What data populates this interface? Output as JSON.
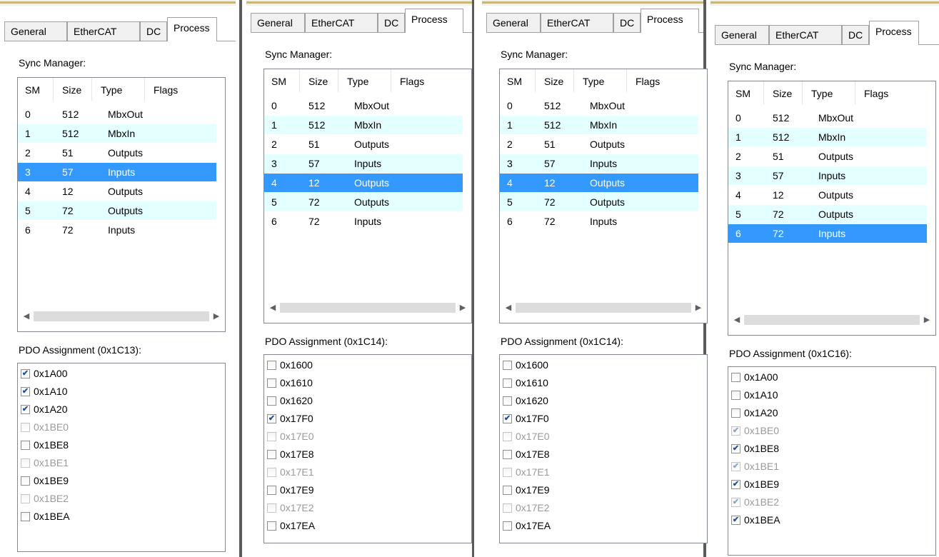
{
  "tabs": [
    "General",
    "EtherCAT",
    "DC",
    "Process"
  ],
  "sync_manager_label": "Sync Manager:",
  "columns": [
    "SM",
    "Size",
    "Type",
    "Flags"
  ],
  "sync_rows": [
    {
      "sm": "0",
      "size": "512",
      "type": "MbxOut"
    },
    {
      "sm": "1",
      "size": "512",
      "type": "MbxIn"
    },
    {
      "sm": "2",
      "size": "51",
      "type": "Outputs"
    },
    {
      "sm": "3",
      "size": "57",
      "type": "Inputs"
    },
    {
      "sm": "4",
      "size": "12",
      "type": "Outputs"
    },
    {
      "sm": "5",
      "size": "72",
      "type": "Outputs"
    },
    {
      "sm": "6",
      "size": "72",
      "type": "Inputs"
    }
  ],
  "panels": [
    {
      "selected_row": 3,
      "pdo_label": "PDO Assignment (0x1C13):",
      "pdo_items": [
        {
          "label": "0x1A00",
          "checked": true,
          "enabled": true
        },
        {
          "label": "0x1A10",
          "checked": true,
          "enabled": true
        },
        {
          "label": "0x1A20",
          "checked": true,
          "enabled": true
        },
        {
          "label": "0x1BE0",
          "checked": false,
          "enabled": false
        },
        {
          "label": "0x1BE8",
          "checked": false,
          "enabled": true
        },
        {
          "label": "0x1BE1",
          "checked": false,
          "enabled": false
        },
        {
          "label": "0x1BE9",
          "checked": false,
          "enabled": true
        },
        {
          "label": "0x1BE2",
          "checked": false,
          "enabled": false
        },
        {
          "label": "0x1BEA",
          "checked": false,
          "enabled": true
        }
      ]
    },
    {
      "selected_row": 4,
      "pdo_label": "PDO Assignment (0x1C14):",
      "pdo_items": [
        {
          "label": "0x1600",
          "checked": false,
          "enabled": true
        },
        {
          "label": "0x1610",
          "checked": false,
          "enabled": true
        },
        {
          "label": "0x1620",
          "checked": false,
          "enabled": true
        },
        {
          "label": "0x17F0",
          "checked": true,
          "enabled": true
        },
        {
          "label": "0x17E0",
          "checked": false,
          "enabled": false
        },
        {
          "label": "0x17E8",
          "checked": false,
          "enabled": true
        },
        {
          "label": "0x17E1",
          "checked": false,
          "enabled": false
        },
        {
          "label": "0x17E9",
          "checked": false,
          "enabled": true
        },
        {
          "label": "0x17E2",
          "checked": false,
          "enabled": false
        },
        {
          "label": "0x17EA",
          "checked": false,
          "enabled": true
        }
      ]
    },
    {
      "selected_row": 4,
      "pdo_label": "PDO Assignment (0x1C14):",
      "pdo_items": [
        {
          "label": "0x1600",
          "checked": false,
          "enabled": true
        },
        {
          "label": "0x1610",
          "checked": false,
          "enabled": true
        },
        {
          "label": "0x1620",
          "checked": false,
          "enabled": true
        },
        {
          "label": "0x17F0",
          "checked": true,
          "enabled": true
        },
        {
          "label": "0x17E0",
          "checked": false,
          "enabled": false
        },
        {
          "label": "0x17E8",
          "checked": false,
          "enabled": true
        },
        {
          "label": "0x17E1",
          "checked": false,
          "enabled": false
        },
        {
          "label": "0x17E9",
          "checked": false,
          "enabled": true
        },
        {
          "label": "0x17E2",
          "checked": false,
          "enabled": false
        },
        {
          "label": "0x17EA",
          "checked": false,
          "enabled": true
        }
      ]
    },
    {
      "selected_row": 6,
      "pdo_label": "PDO Assignment (0x1C16):",
      "pdo_items": [
        {
          "label": "0x1A00",
          "checked": false,
          "enabled": true
        },
        {
          "label": "0x1A10",
          "checked": false,
          "enabled": true
        },
        {
          "label": "0x1A20",
          "checked": false,
          "enabled": true
        },
        {
          "label": "0x1BE0",
          "checked": true,
          "enabled": false
        },
        {
          "label": "0x1BE8",
          "checked": true,
          "enabled": true
        },
        {
          "label": "0x1BE1",
          "checked": true,
          "enabled": false
        },
        {
          "label": "0x1BE9",
          "checked": true,
          "enabled": true
        },
        {
          "label": "0x1BE2",
          "checked": true,
          "enabled": false
        },
        {
          "label": "0x1BEA",
          "checked": true,
          "enabled": true
        }
      ]
    }
  ],
  "colors": {
    "selection": "#3399ff",
    "alternate_row": "#e4ffff",
    "disabled_text": "#9a9a9a"
  },
  "icons": {
    "scroll_left": "◀",
    "scroll_right": "▶",
    "checkmark": "✔"
  }
}
